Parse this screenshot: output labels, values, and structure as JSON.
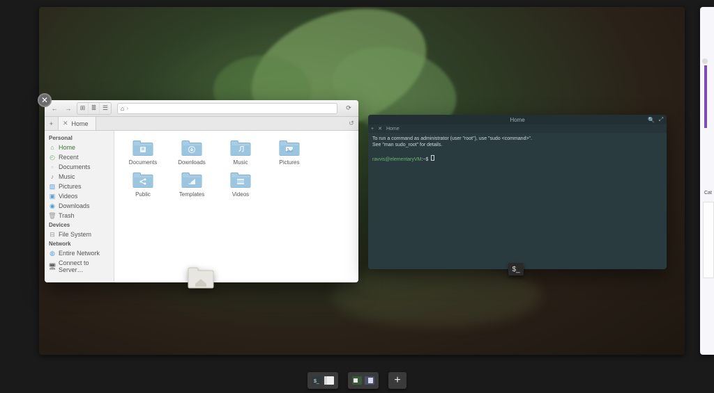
{
  "workspace_peek": {
    "label": "Cat"
  },
  "files_window": {
    "close_glyph": "✕",
    "toolbar": {
      "back": "←",
      "forward": "→",
      "view_icons": "⊞",
      "view_list": "≣",
      "view_cols": "☰",
      "home_glyph": "⌂",
      "path_sep": "›",
      "reload": "⟳"
    },
    "tabs": {
      "add": "+",
      "close": "✕",
      "active": "Home",
      "history": "↺"
    },
    "sidebar": {
      "sections": [
        {
          "title": "Personal",
          "items": [
            {
              "icon": "⌂",
              "label": "Home",
              "name": "home",
              "active": true,
              "color": "#7aa84a"
            },
            {
              "icon": "◴",
              "label": "Recent",
              "name": "recent",
              "color": "#6fb96f"
            },
            {
              "icon": "▫",
              "label": "Documents",
              "name": "documents",
              "color": "#bbb"
            },
            {
              "icon": "♪",
              "label": "Music",
              "name": "music",
              "color": "#888"
            },
            {
              "icon": "▧",
              "label": "Pictures",
              "name": "pictures",
              "color": "#5aa0d8"
            },
            {
              "icon": "▣",
              "label": "Videos",
              "name": "videos",
              "color": "#5aa0d8"
            },
            {
              "icon": "◉",
              "label": "Downloads",
              "name": "downloads",
              "color": "#4aa0d0"
            },
            {
              "icon": "🗑",
              "label": "Trash",
              "name": "trash",
              "color": "#999"
            }
          ]
        },
        {
          "title": "Devices",
          "items": [
            {
              "icon": "⊟",
              "label": "File System",
              "name": "filesystem",
              "color": "#999"
            }
          ]
        },
        {
          "title": "Network",
          "items": [
            {
              "icon": "◍",
              "label": "Entire Network",
              "name": "entire-network",
              "color": "#5aa0d8"
            },
            {
              "icon": "🖥",
              "label": "Connect to Server…",
              "name": "connect-server",
              "color": "#666"
            }
          ]
        }
      ]
    },
    "folders": [
      {
        "label": "Documents",
        "glyph": "doc"
      },
      {
        "label": "Downloads",
        "glyph": "down"
      },
      {
        "label": "Music",
        "glyph": "music"
      },
      {
        "label": "Pictures",
        "glyph": "pic"
      },
      {
        "label": "Public",
        "glyph": "share"
      },
      {
        "label": "Templates",
        "glyph": "tmpl"
      },
      {
        "label": "Videos",
        "glyph": "vid"
      }
    ]
  },
  "terminal": {
    "title": "Home",
    "search": "🔍",
    "maximize": "⤢",
    "tab_add": "+",
    "tab_close": "✕",
    "tab_label": "Home",
    "lines": [
      "To run a command as administrator (user \"root\"), use \"sudo <command>\".",
      "See \"man sudo_root\" for details.",
      ""
    ],
    "prompt_user": "ravvis@elementaryVM",
    "prompt_sep": ":~$ "
  },
  "term_dock": "$_",
  "taskbar": {
    "group1": [
      {
        "name": "terminal",
        "kind": "term"
      },
      {
        "name": "files",
        "kind": "files"
      }
    ],
    "group2": [
      {
        "name": "desktop-1",
        "kind": "desk"
      },
      {
        "name": "desktop-2",
        "kind": "desk2"
      }
    ],
    "plus": "+"
  }
}
